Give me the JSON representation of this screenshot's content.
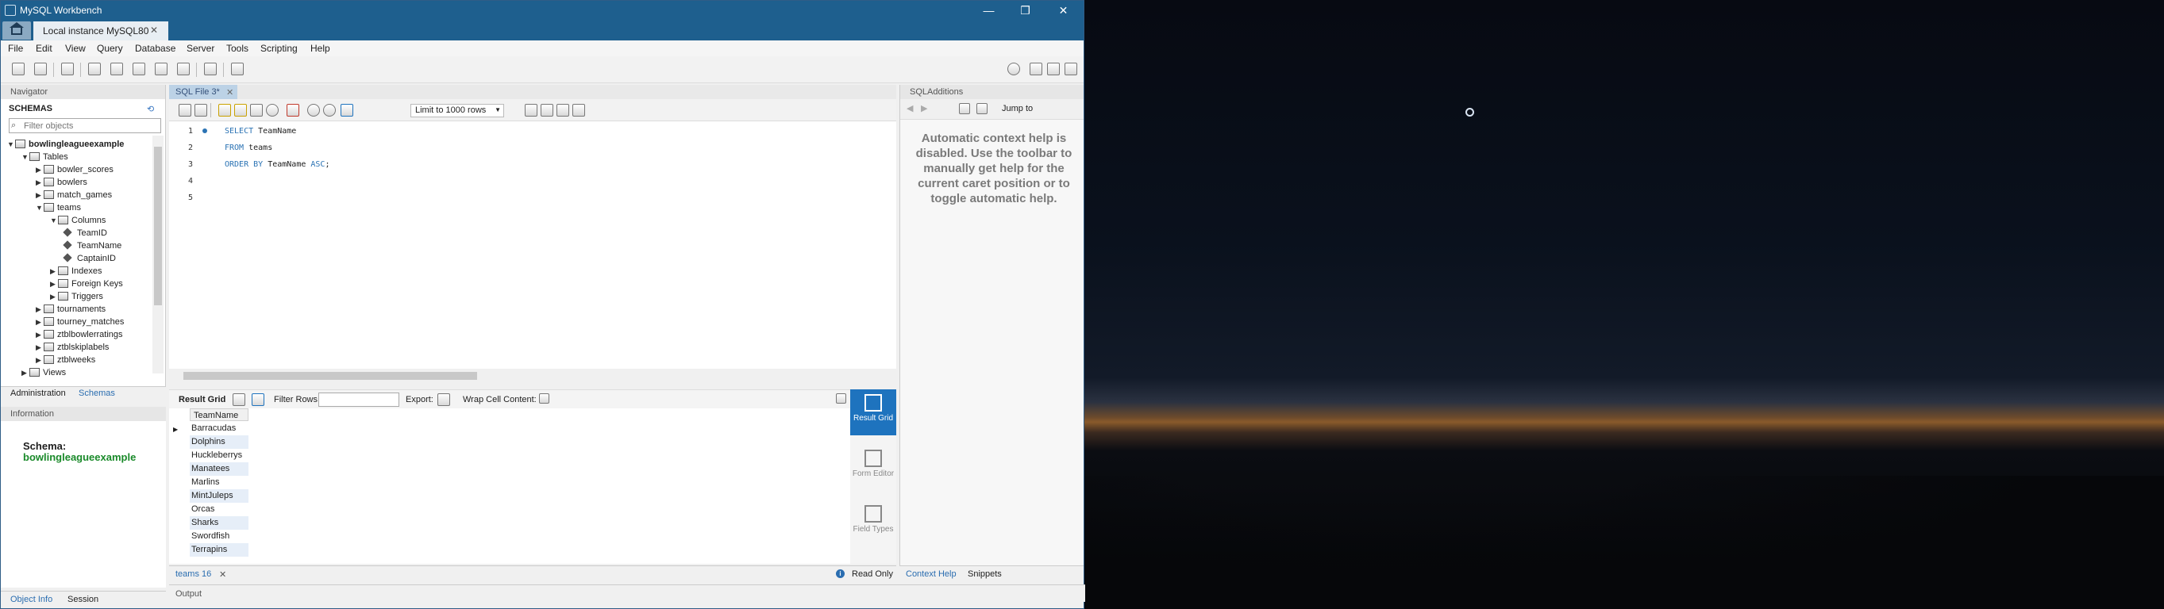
{
  "window": {
    "title": "MySQL Workbench",
    "minimize": "—",
    "restore": "❐",
    "close": "✕"
  },
  "connection_tab": {
    "label": "Local instance MySQL80",
    "close": "✕"
  },
  "menu": [
    "File",
    "Edit",
    "View",
    "Query",
    "Database",
    "Server",
    "Tools",
    "Scripting",
    "Help"
  ],
  "navigator": {
    "panel_title": "Navigator",
    "schemas_title": "SCHEMAS",
    "filter_placeholder": "Filter objects",
    "tree": [
      {
        "label": "bowlingleagueexample",
        "level": 0,
        "expanded": true,
        "bold": true
      },
      {
        "label": "Tables",
        "level": 1,
        "expanded": true
      },
      {
        "label": "bowler_scores",
        "level": 2,
        "expanded": false
      },
      {
        "label": "bowlers",
        "level": 2,
        "expanded": false
      },
      {
        "label": "match_games",
        "level": 2,
        "expanded": false
      },
      {
        "label": "teams",
        "level": 2,
        "expanded": true
      },
      {
        "label": "Columns",
        "level": 3,
        "expanded": true
      },
      {
        "label": "TeamID",
        "level": 4,
        "column": true
      },
      {
        "label": "TeamName",
        "level": 4,
        "column": true
      },
      {
        "label": "CaptainID",
        "level": 4,
        "column": true
      },
      {
        "label": "Indexes",
        "level": 3,
        "expanded": false
      },
      {
        "label": "Foreign Keys",
        "level": 3,
        "expanded": false
      },
      {
        "label": "Triggers",
        "level": 3,
        "expanded": false
      },
      {
        "label": "tournaments",
        "level": 2,
        "expanded": false
      },
      {
        "label": "tourney_matches",
        "level": 2,
        "expanded": false
      },
      {
        "label": "ztblbowlerratings",
        "level": 2,
        "expanded": false
      },
      {
        "label": "ztblskiplabels",
        "level": 2,
        "expanded": false
      },
      {
        "label": "ztblweeks",
        "level": 2,
        "expanded": false
      },
      {
        "label": "Views",
        "level": 1,
        "expanded": false
      }
    ],
    "tabs": {
      "administration": "Administration",
      "schemas": "Schemas"
    }
  },
  "information": {
    "panel_title": "Information",
    "schema_label": "Schema:",
    "schema_value": "bowlingleagueexample",
    "tabs": {
      "object_info": "Object Info",
      "session": "Session"
    }
  },
  "editor": {
    "tab_label": "SQL File 3*",
    "limit": "Limit to 1000 rows",
    "lines": [
      {
        "n": "1",
        "kw": "SELECT",
        "rest": " TeamName",
        "kw2": "",
        "rest2": ""
      },
      {
        "n": "2",
        "kw": "FROM",
        "rest": " teams",
        "kw2": "",
        "rest2": ""
      },
      {
        "n": "3",
        "kw": "ORDER BY",
        "rest": " TeamName ",
        "kw2": "ASC",
        "rest2": ";"
      },
      {
        "n": "4",
        "kw": "",
        "rest": "",
        "kw2": "",
        "rest2": ""
      },
      {
        "n": "5",
        "kw": "",
        "rest": "",
        "kw2": "",
        "rest2": ""
      }
    ]
  },
  "result": {
    "grid_label": "Result Grid",
    "filter_rows_label": "Filter Rows:",
    "export_label": "Export:",
    "wrap_label": "Wrap Cell Content:",
    "column": "TeamName",
    "rows": [
      "Barracudas",
      "Dolphins",
      "Huckleberrys",
      "Manatees",
      "Marlins",
      "MintJuleps",
      "Orcas",
      "Sharks",
      "Swordfish",
      "Terrapins"
    ],
    "side_buttons": {
      "result_grid": "Result Grid",
      "form_editor": "Form Editor",
      "field_types": "Field Types"
    },
    "tab_label": "teams 16",
    "tab_close": "✕",
    "read_only": "Read Only"
  },
  "output": {
    "label": "Output"
  },
  "additions": {
    "panel_title": "SQLAdditions",
    "jump_to": "Jump to",
    "help_text": "Automatic context help is disabled. Use the toolbar to manually get help for the current caret position or to toggle automatic help.",
    "tabs": {
      "context_help": "Context Help",
      "snippets": "Snippets"
    }
  },
  "colors": {
    "titlebar": "#1e5f8e",
    "accent": "#1e73be",
    "keyword": "#2b73b4",
    "schema_green": "#1a8a2a"
  }
}
